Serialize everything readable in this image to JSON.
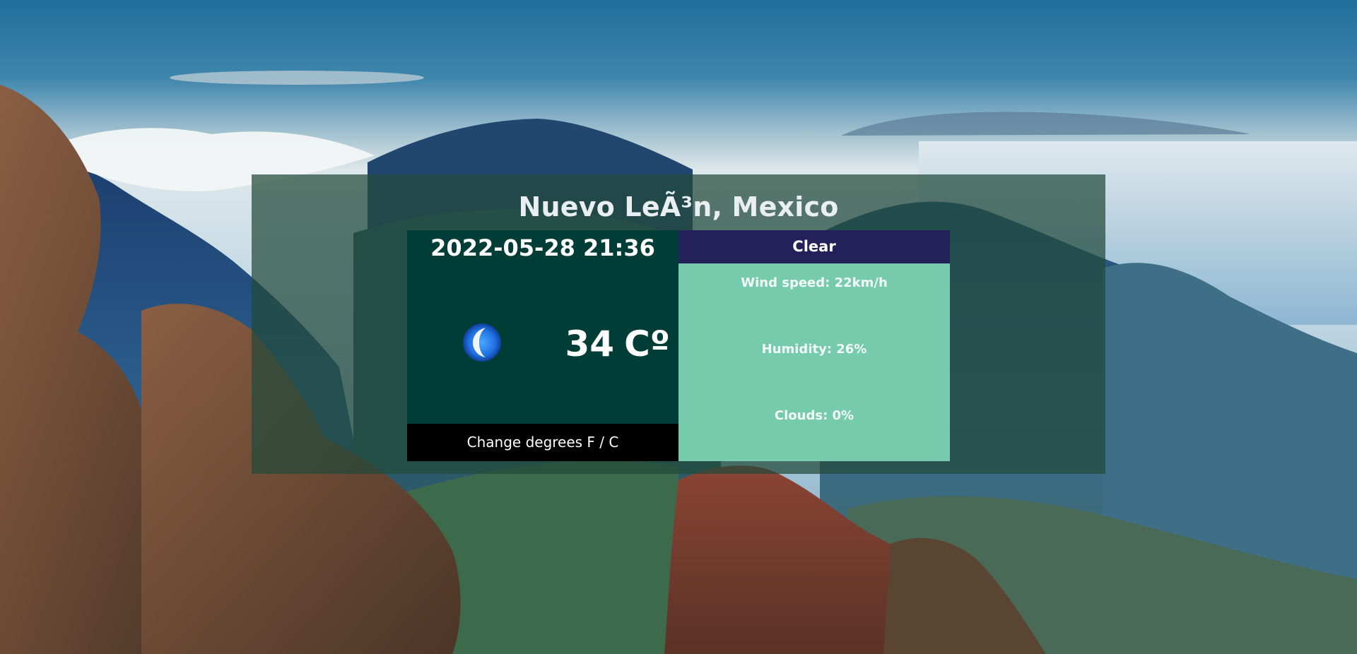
{
  "location": "Nuevo LeÃ³n, Mexico",
  "datetime": "2022-05-28 21:36",
  "current": {
    "icon": "crescent-moon-icon",
    "temperature": "34",
    "unit": "Cº",
    "condition": "Clear"
  },
  "change_degrees_label": "Change degrees F / C",
  "stats": {
    "wind": "Wind speed: 22km/h",
    "humidity": "Humidity: 26%",
    "clouds": "Clouds: 0%"
  },
  "colors": {
    "card_overlay": "#224a3a",
    "left_panel": "#003d36",
    "condition_bar": "#24205a",
    "stats_panel": "#77cbad",
    "button": "#000000"
  }
}
